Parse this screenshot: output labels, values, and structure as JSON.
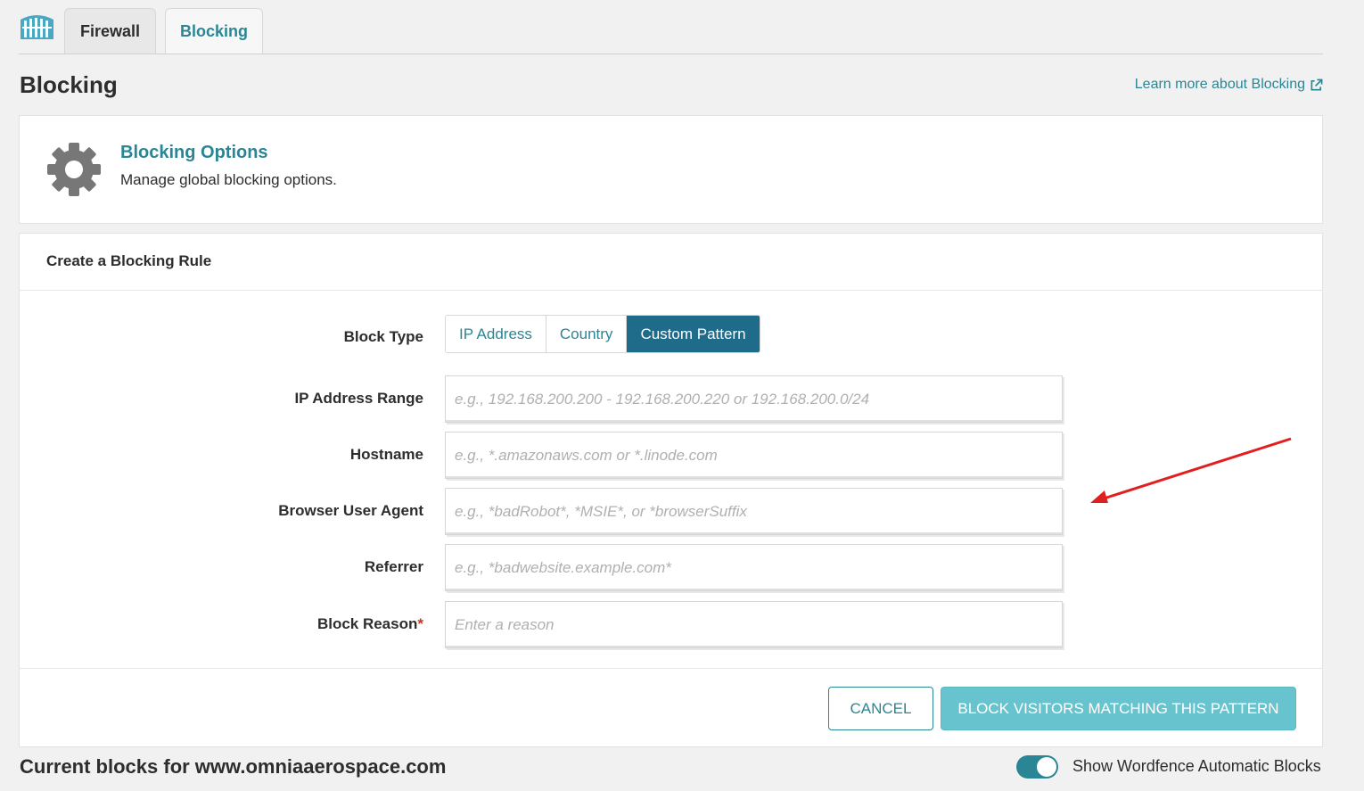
{
  "tabs": [
    {
      "label": "Firewall",
      "active": false
    },
    {
      "label": "Blocking",
      "active": true
    }
  ],
  "page": {
    "title": "Blocking",
    "learn_more": "Learn more about Blocking"
  },
  "options": {
    "title": "Blocking Options",
    "description": "Manage global blocking options."
  },
  "rule": {
    "title": "Create a Blocking Rule",
    "block_type_label": "Block Type",
    "block_types": [
      "IP Address",
      "Country",
      "Custom Pattern"
    ],
    "selected_block_type": "Custom Pattern",
    "fields": [
      {
        "label": "IP Address Range",
        "placeholder": "e.g., 192.168.200.200 - 192.168.200.220 or 192.168.200.0/24",
        "value": ""
      },
      {
        "label": "Hostname",
        "placeholder": "e.g., *.amazonaws.com or *.linode.com",
        "value": ""
      },
      {
        "label": "Browser User Agent",
        "placeholder": "e.g., *badRobot*, *MSIE*, or *browserSuffix",
        "value": ""
      },
      {
        "label": "Referrer",
        "placeholder": "e.g., *badwebsite.example.com*",
        "value": ""
      },
      {
        "label": "Block Reason",
        "required_mark": "*",
        "placeholder": "Enter a reason",
        "value": ""
      }
    ],
    "cancel_label": "CANCEL",
    "submit_label": "BLOCK VISITORS MATCHING THIS PATTERN"
  },
  "current_blocks": {
    "title": "Current blocks for www.omniaaerospace.com",
    "toggle_label": "Show Wordfence Automatic Blocks",
    "toggle_on": true
  },
  "colors": {
    "accent": "#2a8694",
    "active_segment": "#1f6b8a",
    "submit_button": "#67c4cf",
    "annotation_arrow": "#e02020"
  },
  "icons": {
    "logo": "wordfence-logo-icon",
    "external_link": "external-link-icon",
    "gear": "gear-icon",
    "annotation": "red-arrow-icon"
  }
}
